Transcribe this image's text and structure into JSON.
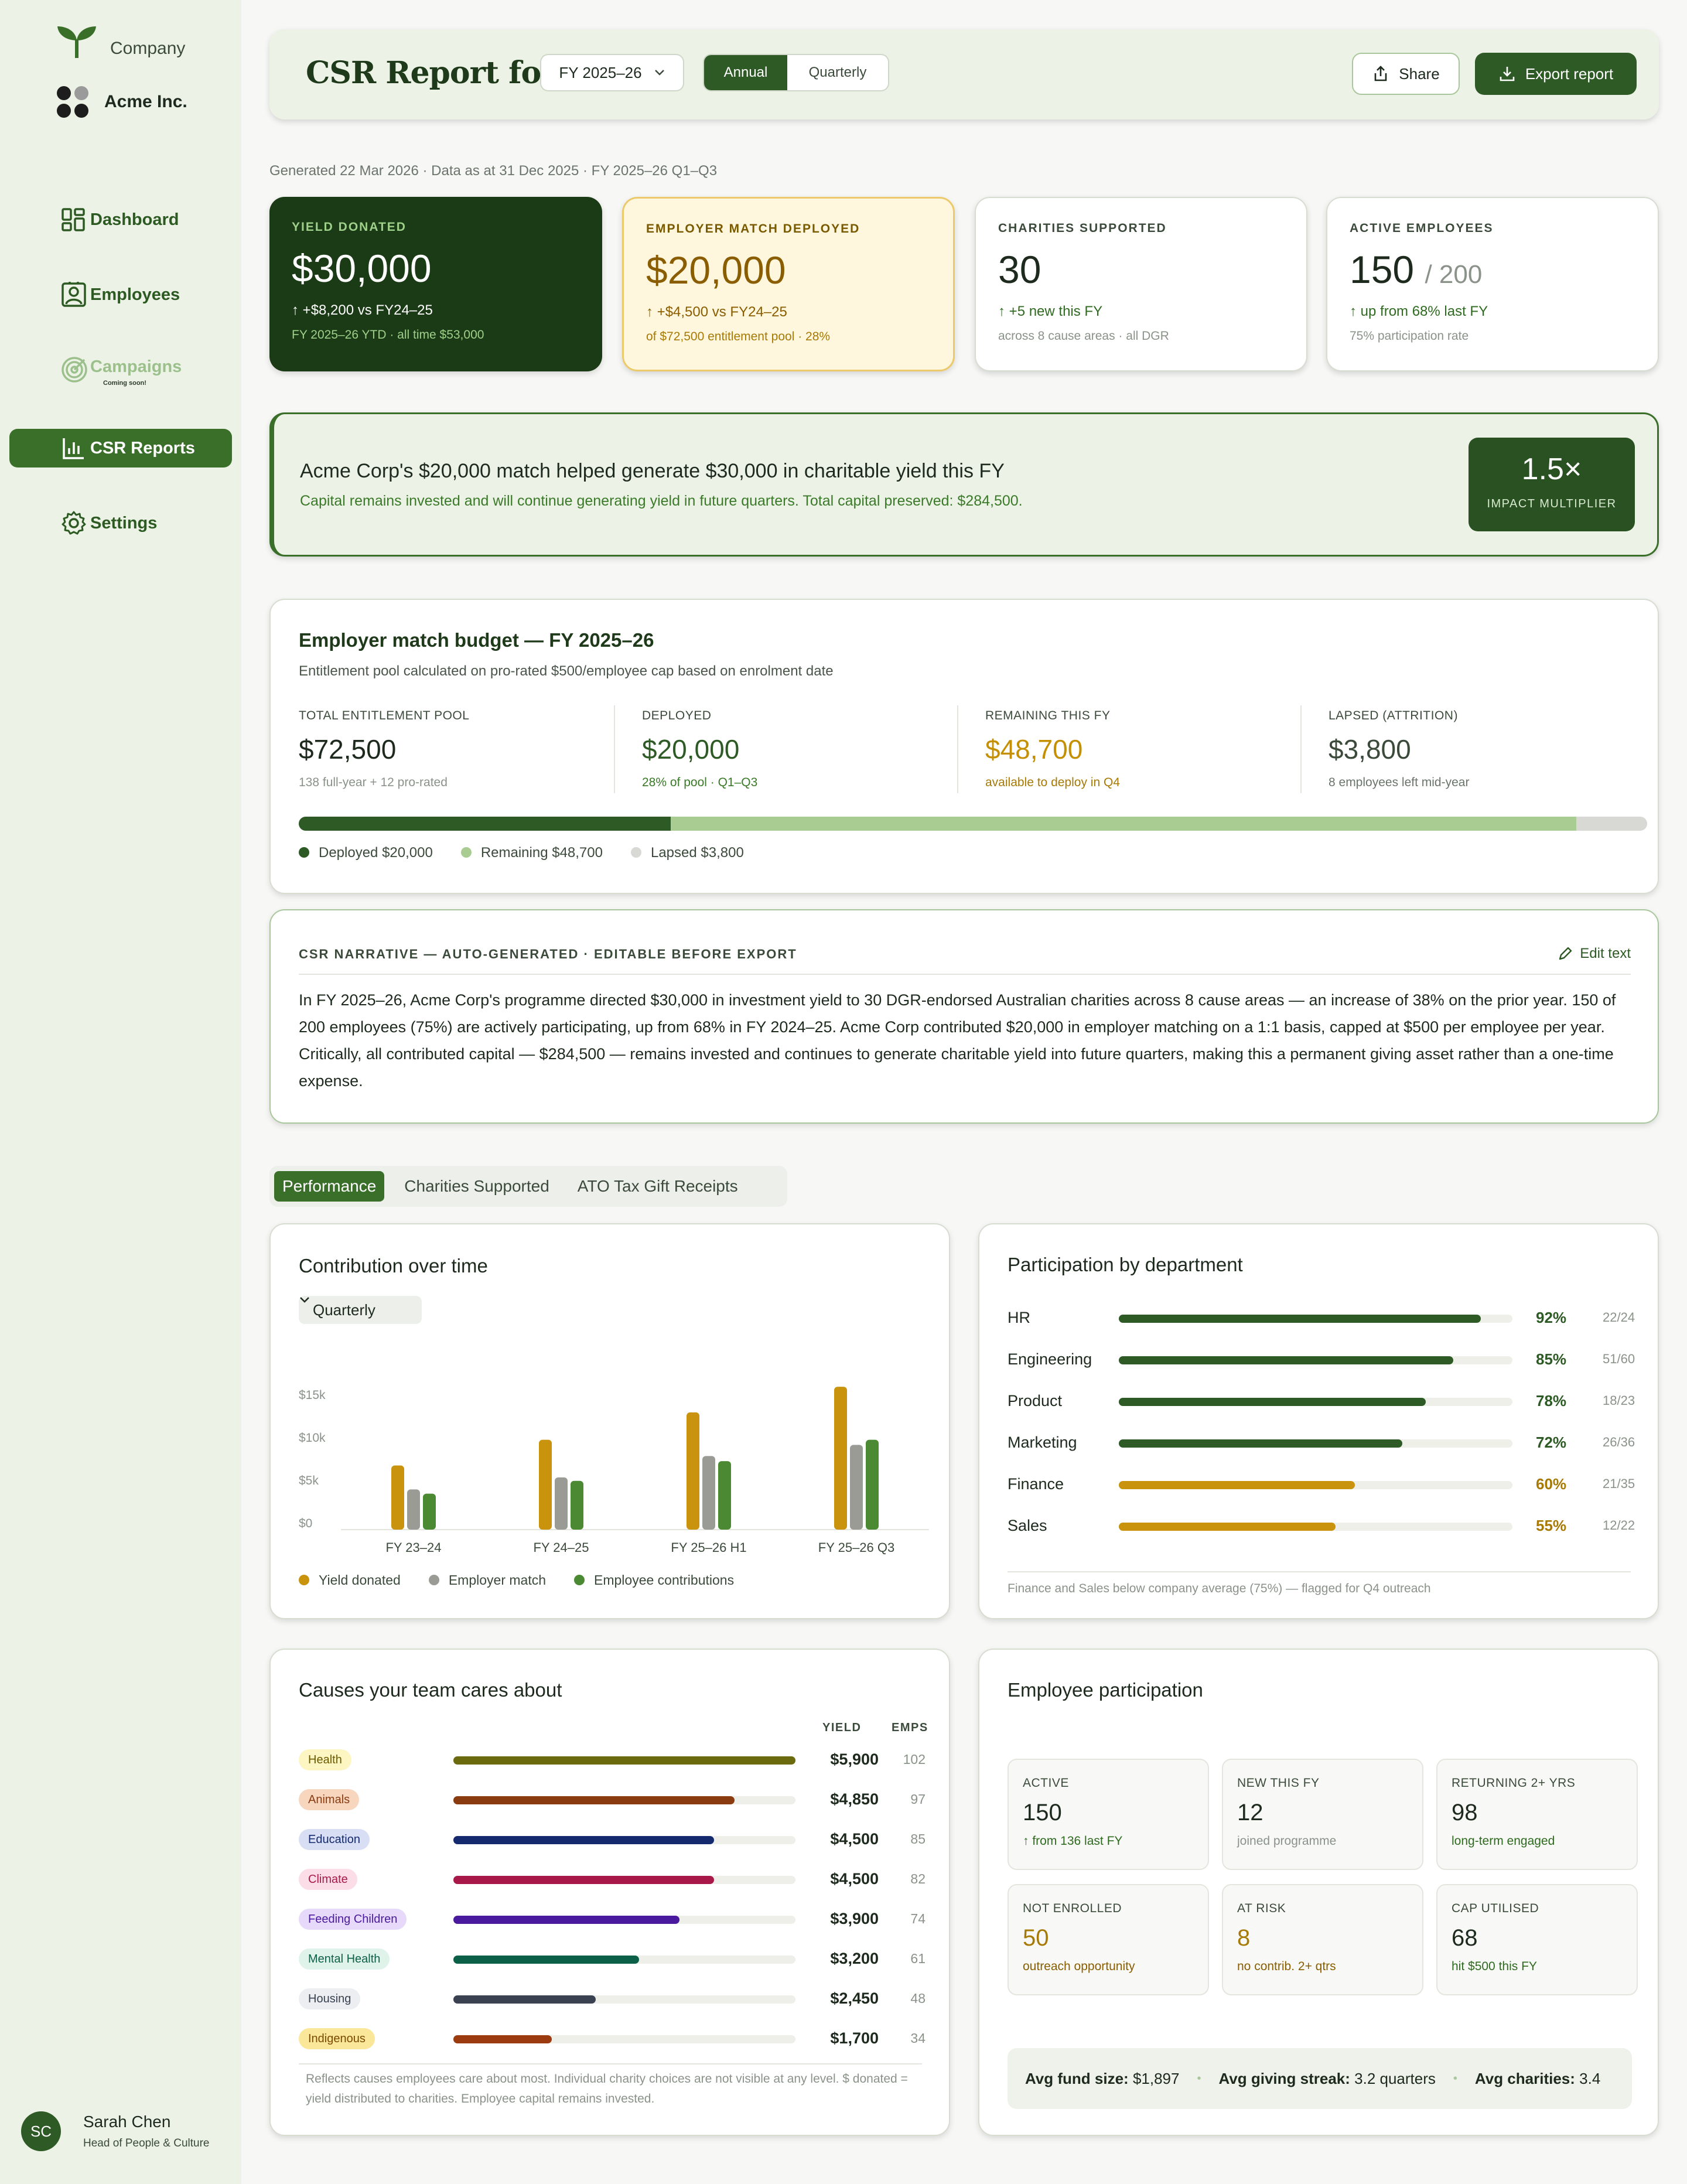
{
  "sidebar": {
    "company_label": "Company",
    "org_name": "Acme Inc.",
    "nav": [
      {
        "label": "Dashboard",
        "icon": "dashboard-icon"
      },
      {
        "label": "Employees",
        "icon": "employees-icon"
      },
      {
        "label": "Campaigns",
        "icon": "campaigns-icon",
        "badge": "Coming soon!"
      },
      {
        "label": "CSR Reports",
        "icon": "bar-chart-icon"
      },
      {
        "label": "Settings",
        "icon": "gear-icon"
      }
    ],
    "user": {
      "initials": "SC",
      "name": "Sarah Chen",
      "role": "Head of People & Culture"
    }
  },
  "header": {
    "title": "CSR Report for",
    "fy_selected": "FY 2025–26",
    "period_options": [
      "Annual",
      "Quarterly"
    ],
    "share_label": "Share",
    "export_label": "Export report"
  },
  "generated_text": "Generated 22 Mar 2026 · Data as at 31 Dec 2025 · FY 2025–26 Q1–Q3",
  "kpis": [
    {
      "label": "YIELD DONATED",
      "value": "$30,000",
      "delta": "+$8,200 vs FY24–25",
      "note": "FY 2025–26 YTD · all time $53,000"
    },
    {
      "label": "EMPLOYER MATCH DEPLOYED",
      "value": "$20,000",
      "delta": "+$4,500 vs FY24–25",
      "note": "of $72,500 entitlement pool · 28%"
    },
    {
      "label": "CHARITIES SUPPORTED",
      "value": "30",
      "delta": "+5 new this FY",
      "note": "across 8 cause areas · all DGR"
    },
    {
      "label": "ACTIVE EMPLOYEES",
      "value": "150",
      "denom": "/ 200",
      "delta": "up from 68% last FY",
      "note": "75% participation rate"
    }
  ],
  "banner": {
    "title": "Acme Corp's $20,000 match helped generate $30,000 in charitable yield this FY",
    "subtitle": "Capital remains invested and will continue generating yield in future quarters. Total capital preserved: $284,500.",
    "multiplier": "1.5×",
    "multiplier_label": "IMPACT MULTIPLIER"
  },
  "budget": {
    "title": "Employer match budget — FY 2025–26",
    "description": "Entitlement pool calculated on pro-rated $500/employee cap based on enrolment date",
    "columns": [
      {
        "label": "TOTAL ENTITLEMENT POOL",
        "value": "$72,500",
        "note": "138 full-year + 12 pro-rated",
        "color": "#1d2a1d",
        "note_color": "#8a928a"
      },
      {
        "label": "DEPLOYED",
        "value": "$20,000",
        "note": "28% of pool · Q1–Q3",
        "color": "#2e5a25",
        "note_color": "#3a7a28"
      },
      {
        "label": "REMAINING THIS FY",
        "value": "$48,700",
        "note": "available to deploy in Q4",
        "color": "#c48f00",
        "note_color": "#a77a06"
      },
      {
        "label": "LAPSED (ATTRITION)",
        "value": "$3,800",
        "note": "8 employees left mid-year",
        "color": "#3b4a3b",
        "note_color": "#6b756b"
      }
    ],
    "bar": {
      "deployed": 20000,
      "remaining": 48700,
      "lapsed": 3800
    },
    "legend": [
      {
        "label": "Deployed $20,000",
        "color": "#2e5a25"
      },
      {
        "label": "Remaining $48,700",
        "color": "#a8cc92"
      },
      {
        "label": "Lapsed $3,800",
        "color": "#d8d8d4"
      }
    ]
  },
  "narrative": {
    "label": "CSR NARRATIVE — AUTO-GENERATED · EDITABLE BEFORE EXPORT",
    "edit_label": "Edit text",
    "text": "In FY 2025–26, Acme Corp's programme directed $30,000 in investment yield to 30 DGR-endorsed Australian charities across 8 cause areas — an increase of 38% on the prior year. 150 of 200 employees (75%) are actively participating, up from 68% in FY 2024–25. Acme Corp contributed $20,000 in employer matching on a 1:1 basis, capped at $500 per employee per year. Critically, all contributed capital — $284,500 — remains invested and continues to generate charitable yield into future quarters, making this a permanent giving asset rather than a one-time expense."
  },
  "tabs": [
    "Performance",
    "Charities Supported",
    "ATO Tax Gift Receipts"
  ],
  "contribution": {
    "title": "Contribution over time",
    "period_select": "Quarterly"
  },
  "chart_data": {
    "type": "bar",
    "categories": [
      "FY 23–24",
      "FY 24–25",
      "FY 25–26 H1",
      "FY 25–26 Q3"
    ],
    "series": [
      {
        "name": "Yield donated",
        "values": [
          7500,
          10500,
          13700,
          16700
        ],
        "color": "#c9930e"
      },
      {
        "name": "Employer match",
        "values": [
          4700,
          6100,
          8600,
          9900
        ],
        "color": "#9b9b96"
      },
      {
        "name": "Employee contributions",
        "values": [
          4200,
          5700,
          8000,
          10500
        ],
        "color": "#4b8a33"
      }
    ],
    "yticks": [
      "$0",
      "$5k",
      "$10k",
      "$15k"
    ],
    "ylim": [
      0,
      20000
    ]
  },
  "departments": {
    "title": "Participation by department",
    "rows": [
      {
        "name": "HR",
        "pct": 92,
        "pct_label": "92%",
        "count": "22/24",
        "color": "#2e5a25"
      },
      {
        "name": "Engineering",
        "pct": 85,
        "pct_label": "85%",
        "count": "51/60",
        "color": "#2e5a25"
      },
      {
        "name": "Product",
        "pct": 78,
        "pct_label": "78%",
        "count": "18/23",
        "color": "#2e5a25"
      },
      {
        "name": "Marketing",
        "pct": 72,
        "pct_label": "72%",
        "count": "26/36",
        "color": "#2e5a25"
      },
      {
        "name": "Finance",
        "pct": 60,
        "pct_label": "60%",
        "count": "21/35",
        "color": "#c9930e"
      },
      {
        "name": "Sales",
        "pct": 55,
        "pct_label": "55%",
        "count": "12/22",
        "color": "#c9930e"
      }
    ],
    "note": "Finance and Sales below company average (75%) — flagged for Q4 outreach"
  },
  "causes": {
    "title": "Causes your team cares about",
    "col_yield": "YIELD",
    "col_emps": "EMPS",
    "rows": [
      {
        "name": "Health",
        "yield": "$5,900",
        "amount": 5900,
        "emps": "102",
        "bar": "#6b6a0e",
        "tag_bg": "#fdf6c2",
        "tag_fg": "#6b5a00"
      },
      {
        "name": "Animals",
        "yield": "$4,850",
        "amount": 4850,
        "emps": "97",
        "bar": "#8a3b10",
        "tag_bg": "#f8d6bd",
        "tag_fg": "#8a3b10"
      },
      {
        "name": "Education",
        "yield": "$4,500",
        "amount": 4500,
        "emps": "85",
        "bar": "#152a6e",
        "tag_bg": "#d8def4",
        "tag_fg": "#152a6e"
      },
      {
        "name": "Climate",
        "yield": "$4,500",
        "amount": 4500,
        "emps": "82",
        "bar": "#a8194a",
        "tag_bg": "#fbdde7",
        "tag_fg": "#a8194a"
      },
      {
        "name": "Feeding Children",
        "yield": "$3,900",
        "amount": 3900,
        "emps": "74",
        "bar": "#4a1a9e",
        "tag_bg": "#e6d9fa",
        "tag_fg": "#4a1a9e"
      },
      {
        "name": "Mental Health",
        "yield": "$3,200",
        "amount": 3200,
        "emps": "61",
        "bar": "#0d6048",
        "tag_bg": "#e0f3ea",
        "tag_fg": "#0d6048"
      },
      {
        "name": "Housing",
        "yield": "$2,450",
        "amount": 2450,
        "emps": "48",
        "bar": "#3a4252",
        "tag_bg": "#eceef1",
        "tag_fg": "#3a4252"
      },
      {
        "name": "Indigenous",
        "yield": "$1,700",
        "amount": 1700,
        "emps": "34",
        "bar": "#9c3b10",
        "tag_bg": "#fbe79a",
        "tag_fg": "#7a4a00"
      }
    ],
    "max_amount": 5900,
    "note": "Reflects causes employees care about most. Individual charity choices are not visible at any level. $ donated = yield distributed to charities. Employee capital remains invested."
  },
  "employee_participation": {
    "title": "Employee participation",
    "boxes": [
      {
        "label": "ACTIVE",
        "value": "150",
        "note": "from 136 last FY",
        "value_color": "#1d2a1d",
        "note_color": "#2e6a1f",
        "arrow": true
      },
      {
        "label": "NEW THIS FY",
        "value": "12",
        "note": "joined programme",
        "value_color": "#1d2a1d",
        "note_color": "#8a928a",
        "arrow": false
      },
      {
        "label": "RETURNING 2+ YRS",
        "value": "98",
        "note": "long-term engaged",
        "value_color": "#1d2a1d",
        "note_color": "#2e6a1f",
        "arrow": false
      },
      {
        "label": "NOT ENROLLED",
        "value": "50",
        "note": "outreach opportunity",
        "value_color": "#a77a06",
        "note_color": "#8a5d00",
        "arrow": false
      },
      {
        "label": "AT RISK",
        "value": "8",
        "note": "no contrib. 2+ qtrs",
        "value_color": "#a77a06",
        "note_color": "#8a5d00",
        "arrow": false
      },
      {
        "label": "CAP UTILISED",
        "value": "68",
        "note": "hit $500 this FY",
        "value_color": "#1d2a1d",
        "note_color": "#2e6a1f",
        "arrow": false
      }
    ],
    "summary": [
      {
        "label": "Avg fund size:",
        "value": "$1,897"
      },
      {
        "label": "Avg giving streak:",
        "value": "3.2 quarters"
      },
      {
        "label": "Avg charities:",
        "value": "3.4"
      }
    ]
  }
}
